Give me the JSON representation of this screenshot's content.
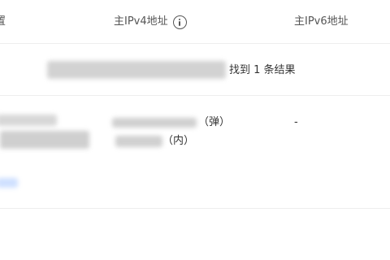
{
  "table": {
    "columns": {
      "first_partial": "置",
      "primary_ipv4": "主IPv4地址",
      "primary_ipv6": "主IPv6地址"
    },
    "search_result": "找到 1 条结果",
    "rows": [
      {
        "ipv4_public_tag": "（弹）",
        "ipv4_private_tag": "（内）",
        "ipv6": "-"
      }
    ]
  },
  "icons": {
    "ipv4_header": "info-icon"
  },
  "colors": {
    "border": "#eeeeee",
    "text": "#333333",
    "link_blur": "#cfe0ff"
  }
}
